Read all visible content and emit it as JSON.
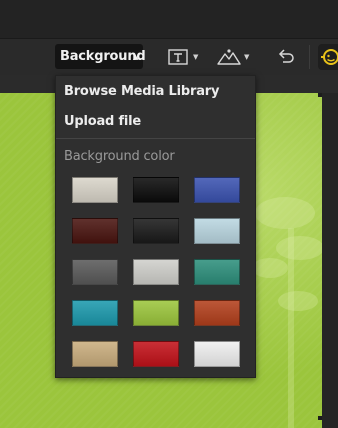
{
  "toolbar": {
    "background_label": "Background",
    "text_tool_icon": "text-box-icon",
    "image_tool_icon": "mountain-image-icon",
    "undo_icon": "undo-arrow-icon",
    "accent_icon": "face-icon",
    "accent_color": "#e8c21a"
  },
  "menu": {
    "browse_label": "Browse Media Library",
    "upload_label": "Upload file",
    "section_label": "Background color"
  },
  "canvas": {
    "color": "#9bc53c"
  },
  "swatches": [
    {
      "name": "light-linen",
      "color": "#d8d4c8"
    },
    {
      "name": "black",
      "color": "#0b0b0b"
    },
    {
      "name": "royal-blue",
      "color": "#3b53b0"
    },
    {
      "name": "dark-red-grunge",
      "color": "#4a1510"
    },
    {
      "name": "charcoal",
      "color": "#1a1a1a"
    },
    {
      "name": "light-blue-texture",
      "color": "#b9d6e0"
    },
    {
      "name": "dark-gray",
      "color": "#5a5a5a"
    },
    {
      "name": "light-gray",
      "color": "#cfcfcb"
    },
    {
      "name": "teal",
      "color": "#2e8f7c"
    },
    {
      "name": "cyan-teal",
      "color": "#1c9aad"
    },
    {
      "name": "lime-green",
      "color": "#9cc63c"
    },
    {
      "name": "rust",
      "color": "#b3401d"
    },
    {
      "name": "parchment",
      "color": "#c9ad7d"
    },
    {
      "name": "red",
      "color": "#c3121a"
    },
    {
      "name": "white",
      "color": "#efefef"
    }
  ]
}
